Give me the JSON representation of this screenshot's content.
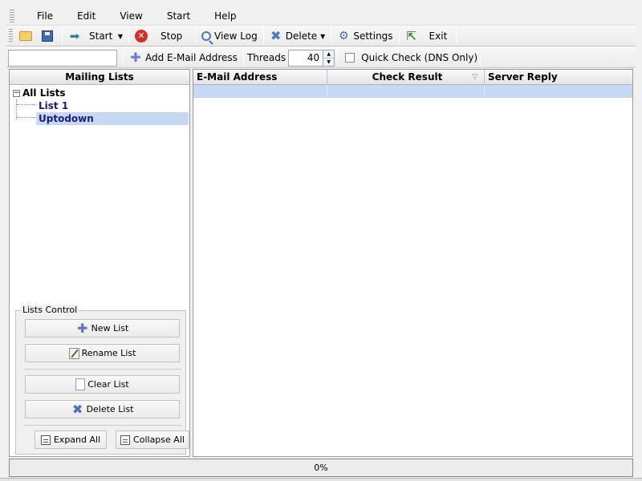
{
  "menu": [
    "File",
    "Edit",
    "View",
    "Start",
    "Help"
  ],
  "toolbar": {
    "start_label": "Start",
    "stop_label": "Stop",
    "viewlog_label": "View Log",
    "delete_label": "Delete",
    "settings_label": "Settings",
    "exit_label": "Exit"
  },
  "toolbar2": {
    "email_value": "",
    "add_email_label": "Add E-Mail Address",
    "threads_label": "Threads",
    "threads_value": "40",
    "quick_check_label": "Quick Check (DNS Only)"
  },
  "left_panel": {
    "header": "Mailing Lists",
    "tree": {
      "root": "All Lists",
      "children": [
        "List 1",
        "Uptodown"
      ]
    },
    "lists_control": {
      "legend": "Lists Control",
      "new_list": "New List",
      "rename_list": "Rename List",
      "clear_list": "Clear List",
      "delete_list": "Delete List",
      "expand_all": "Expand All",
      "collapse_all": "Collapse All"
    }
  },
  "grid": {
    "columns": [
      "E-Mail Address",
      "Check Result",
      "Server Reply"
    ]
  },
  "status": {
    "progress_text": "0%"
  }
}
